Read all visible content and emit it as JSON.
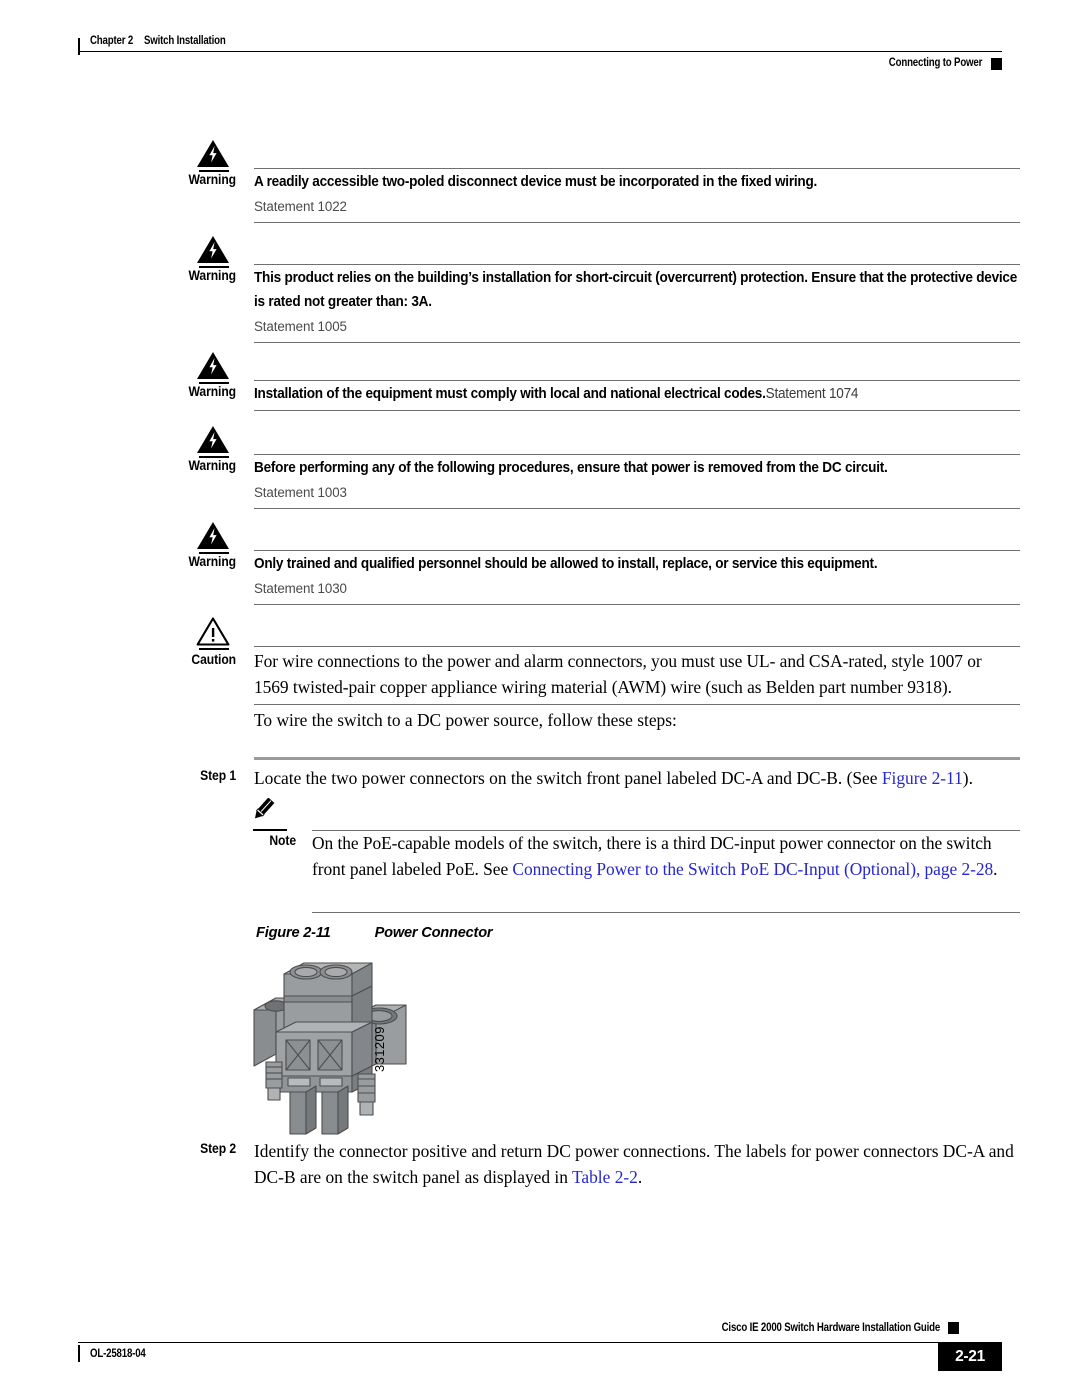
{
  "header": {
    "chapter_number": "Chapter 2",
    "chapter_title": "Switch Installation",
    "section_title": "Connecting to Power"
  },
  "admonitions": [
    {
      "icon": "warning-triangle-bolt-icon",
      "label": "Warning",
      "text": "A readily accessible two-poled disconnect device must be incorporated in the fixed wiring.",
      "statement": "Statement 1022"
    },
    {
      "icon": "warning-triangle-bolt-icon",
      "label": "Warning",
      "text": "This product relies on the building’s installation for short-circuit (overcurrent) protection. Ensure that the protective device is rated not greater than: 3A.",
      "statement": "Statement 1005"
    },
    {
      "icon": "warning-triangle-bolt-icon",
      "label": "Warning",
      "text": "Installation of the equipment must comply with local and national electrical codes.",
      "statement": "Statement 1074"
    },
    {
      "icon": "warning-triangle-bolt-icon",
      "label": "Warning",
      "text": "Before performing any of the following procedures, ensure that power is removed from the DC circuit.",
      "statement": "Statement 1003"
    },
    {
      "icon": "warning-triangle-bolt-icon",
      "label": "Warning",
      "text": "Only trained and qualified personnel should be allowed to install, replace, or service this equipment.",
      "statement": "Statement 1030"
    },
    {
      "icon": "caution-triangle-exclamation-icon",
      "label": "Caution",
      "text": "For wire connections to the power and alarm connectors, you must use UL- and CSA-rated, style 1007 or 1569 twisted-pair copper appliance wiring material (AWM) wire (such as Belden part number 9318)."
    }
  ],
  "intro_paragraph": "To wire the switch to a DC power source, follow these steps:",
  "steps": [
    {
      "label": "Step 1",
      "text_before_link": "Locate the two power connectors on the switch front panel labeled DC-A and DC-B. (See ",
      "link": "Figure 2-11",
      "text_after_link": ")."
    },
    {
      "label": "Step 2",
      "text_before_link": "Identify the connector positive and return DC power connections. The labels for power connectors DC-A and DC-B are on the switch panel as displayed in ",
      "link": "Table 2-2",
      "text_after_link": "."
    }
  ],
  "note": {
    "icon": "note-pencil-icon",
    "label": "Note",
    "text_before_link": "On the PoE-capable models of the switch, there is a third DC-input power connector on the switch front panel labeled PoE. See ",
    "link": "Connecting Power to the Switch PoE DC-Input (Optional), page 2-28",
    "text_after_link": "."
  },
  "figure": {
    "number": "Figure 2-11",
    "title": "Power Connector",
    "art_id": "331209",
    "art_name": "power-connector-illustration"
  },
  "footer": {
    "doc_id": "OL-25818-04",
    "guide_title": "Cisco IE 2000 Switch Hardware Installation Guide",
    "page_number": "2-21"
  },
  "colors": {
    "link": "#2626cf",
    "rule": "#6f6f6f",
    "step_rule": "#9a9a9a"
  }
}
